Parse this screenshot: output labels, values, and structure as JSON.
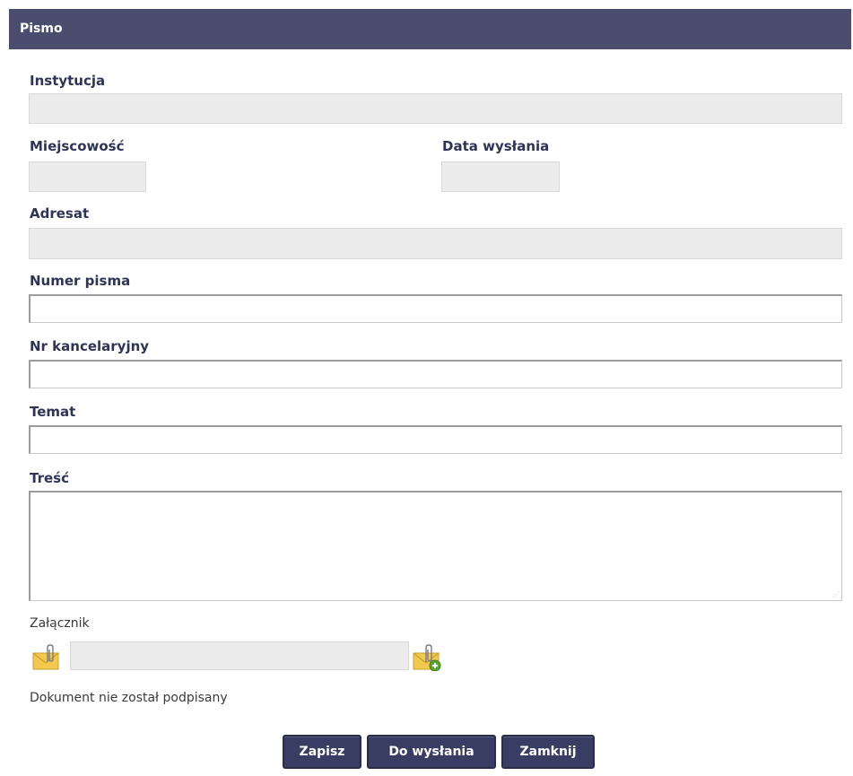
{
  "dialog": {
    "title": "Pismo"
  },
  "form": {
    "instytucja": {
      "label": "Instytucja",
      "value": ""
    },
    "miejscowosc": {
      "label": "Miejscowość",
      "value": ""
    },
    "data_wyslania": {
      "label": "Data wysłania",
      "value": ""
    },
    "adresat": {
      "label": "Adresat",
      "value": ""
    },
    "numer_pisma": {
      "label": "Numer pisma",
      "value": ""
    },
    "nr_kancelaryjny": {
      "label": "Nr kancelaryjny",
      "value": ""
    },
    "temat": {
      "label": "Temat",
      "value": ""
    },
    "tresc": {
      "label": "Treść",
      "value": ""
    },
    "zalacznik": {
      "label": "Załącznik",
      "value": ""
    }
  },
  "icons": {
    "attachment_left": "envelope-paperclip-icon",
    "attachment_add": "envelope-paperclip-add-icon"
  },
  "status": {
    "signature": "Dokument nie został podpisany"
  },
  "buttons": {
    "save": "Zapisz",
    "to_send": "Do wysłania",
    "close": "Zamknij"
  },
  "colors": {
    "header": "#4a4d6e",
    "button": "#3a3d63",
    "readonly_field": "#ececec",
    "icon_envelope": "#f2c94c",
    "icon_add": "#5aa832"
  }
}
